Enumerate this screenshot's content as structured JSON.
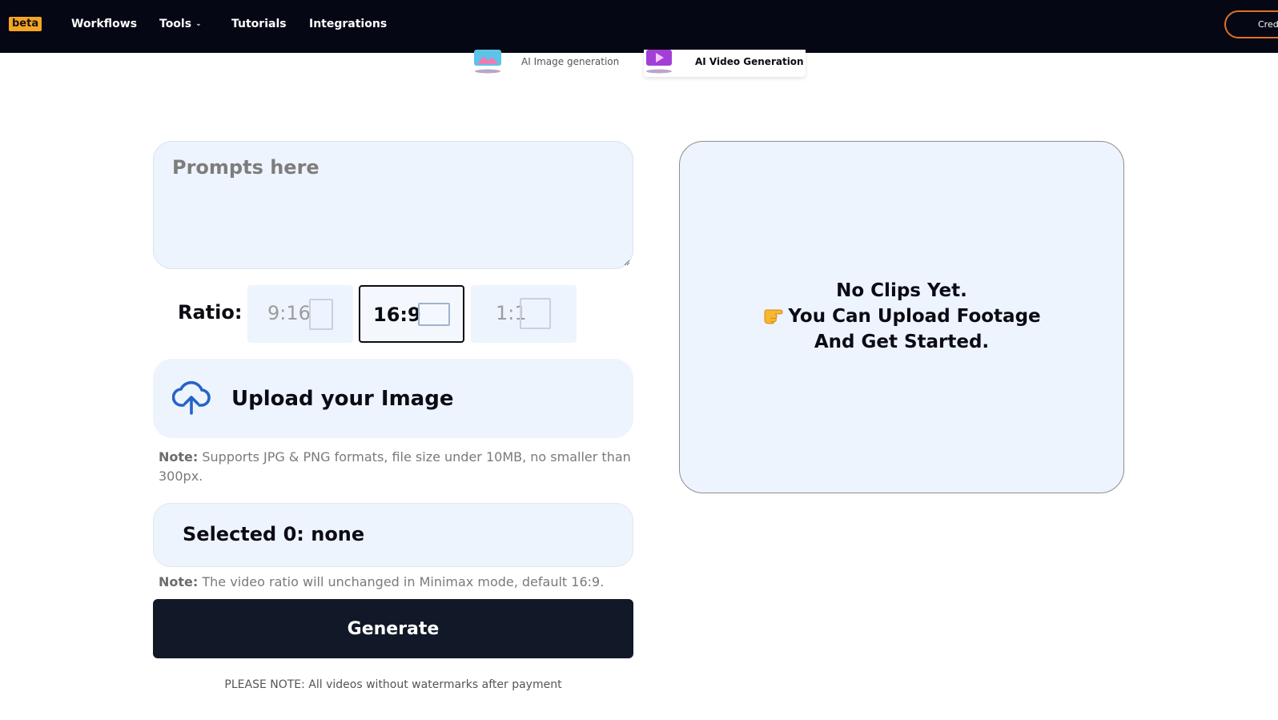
{
  "nav": {
    "badge": "beta",
    "items": [
      {
        "label": "Workflows"
      },
      {
        "label": "Tools",
        "has_dropdown": true
      },
      {
        "label": "Tutorials"
      },
      {
        "label": "Integrations"
      }
    ],
    "credits_label": "Credits"
  },
  "mode_tabs": [
    {
      "label": "AI Image generation",
      "active": false
    },
    {
      "label": "AI Video Generation",
      "active": true
    }
  ],
  "form": {
    "prompt_placeholder": "Prompts here",
    "prompt_value": "",
    "ratio_label": "Ratio:",
    "ratios": [
      {
        "label": "9:16",
        "selected": false
      },
      {
        "label": "16:9",
        "selected": true
      },
      {
        "label": "1:1",
        "selected": false
      }
    ],
    "upload_label": "Upload your Image",
    "note_prefix": "Note:",
    "upload_note": "Supports JPG & PNG formats, file size under 10MB, no smaller than 300px.",
    "selected_label": "Selected 0: none",
    "ratio_note": "The video ratio will unchanged in Minimax mode, default 16:9.",
    "generate_label": "Generate",
    "payment_note": "PLEASE NOTE: All videos without watermarks after payment"
  },
  "preview": {
    "line1": "No Clips Yet.",
    "line2": "You Can Upload Footage",
    "line3": "And Get Started.",
    "hand_icon": "pointing-hand-icon"
  },
  "colors": {
    "nav_bg": "#050814",
    "badge": "#f5a524",
    "credits_border": "#e46f24",
    "panel_bg": "#eef4fd",
    "generate_bg": "#111827",
    "upload_icon": "#2563c9"
  }
}
